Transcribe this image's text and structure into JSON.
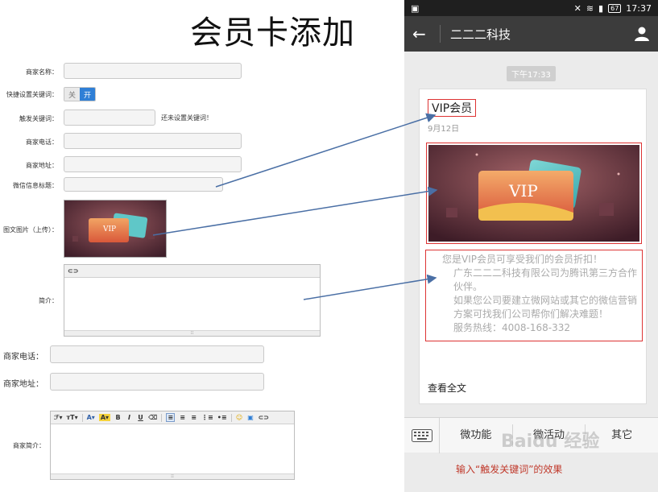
{
  "page_title": "会员卡添加",
  "form": {
    "merchant_name_label": "商家名称：",
    "quick_keyword_label": "快捷设置关键词：",
    "toggle_off": "关",
    "toggle_on": "开",
    "trigger_keyword_label": "触发关键词：",
    "trigger_keyword_hint": "还未设置关键词！",
    "merchant_phone_label": "商家电话：",
    "merchant_address_label": "商家地址：",
    "wechat_title_label": "微信信息标题：",
    "image_label": "图文图片（上传）：",
    "intro_label": "简介：",
    "merchant_phone_label_2": "商家电话：",
    "merchant_address_label_2": "商家地址：",
    "merchant_intro_label": "商家简介："
  },
  "phone": {
    "status_time": "17:37",
    "battery": "67",
    "nav_title": "二二二科技",
    "message_time": "下午17:33",
    "card_title": "VIP会员",
    "card_date": "9月12日",
    "card_desc": [
      "您是VIP会员可享受我们的会员折扣！",
      "广东二二二科技有限公司为腾讯第三方合作伙伴。",
      "如果您公司要建立微网站或其它的微信营销方案可找我们公司帮你们解决难题！",
      "服务热线：4008-168-332"
    ],
    "read_more": "查看全文",
    "menu": [
      "微功能",
      "微活动",
      "其它"
    ],
    "caption": "输入“触发关键词”的效果",
    "watermark": "Baidu 经验"
  },
  "colors": {
    "accent_blue": "#2f7fd6",
    "highlight_red": "#d33333",
    "arrow": "#4a6fa5"
  }
}
